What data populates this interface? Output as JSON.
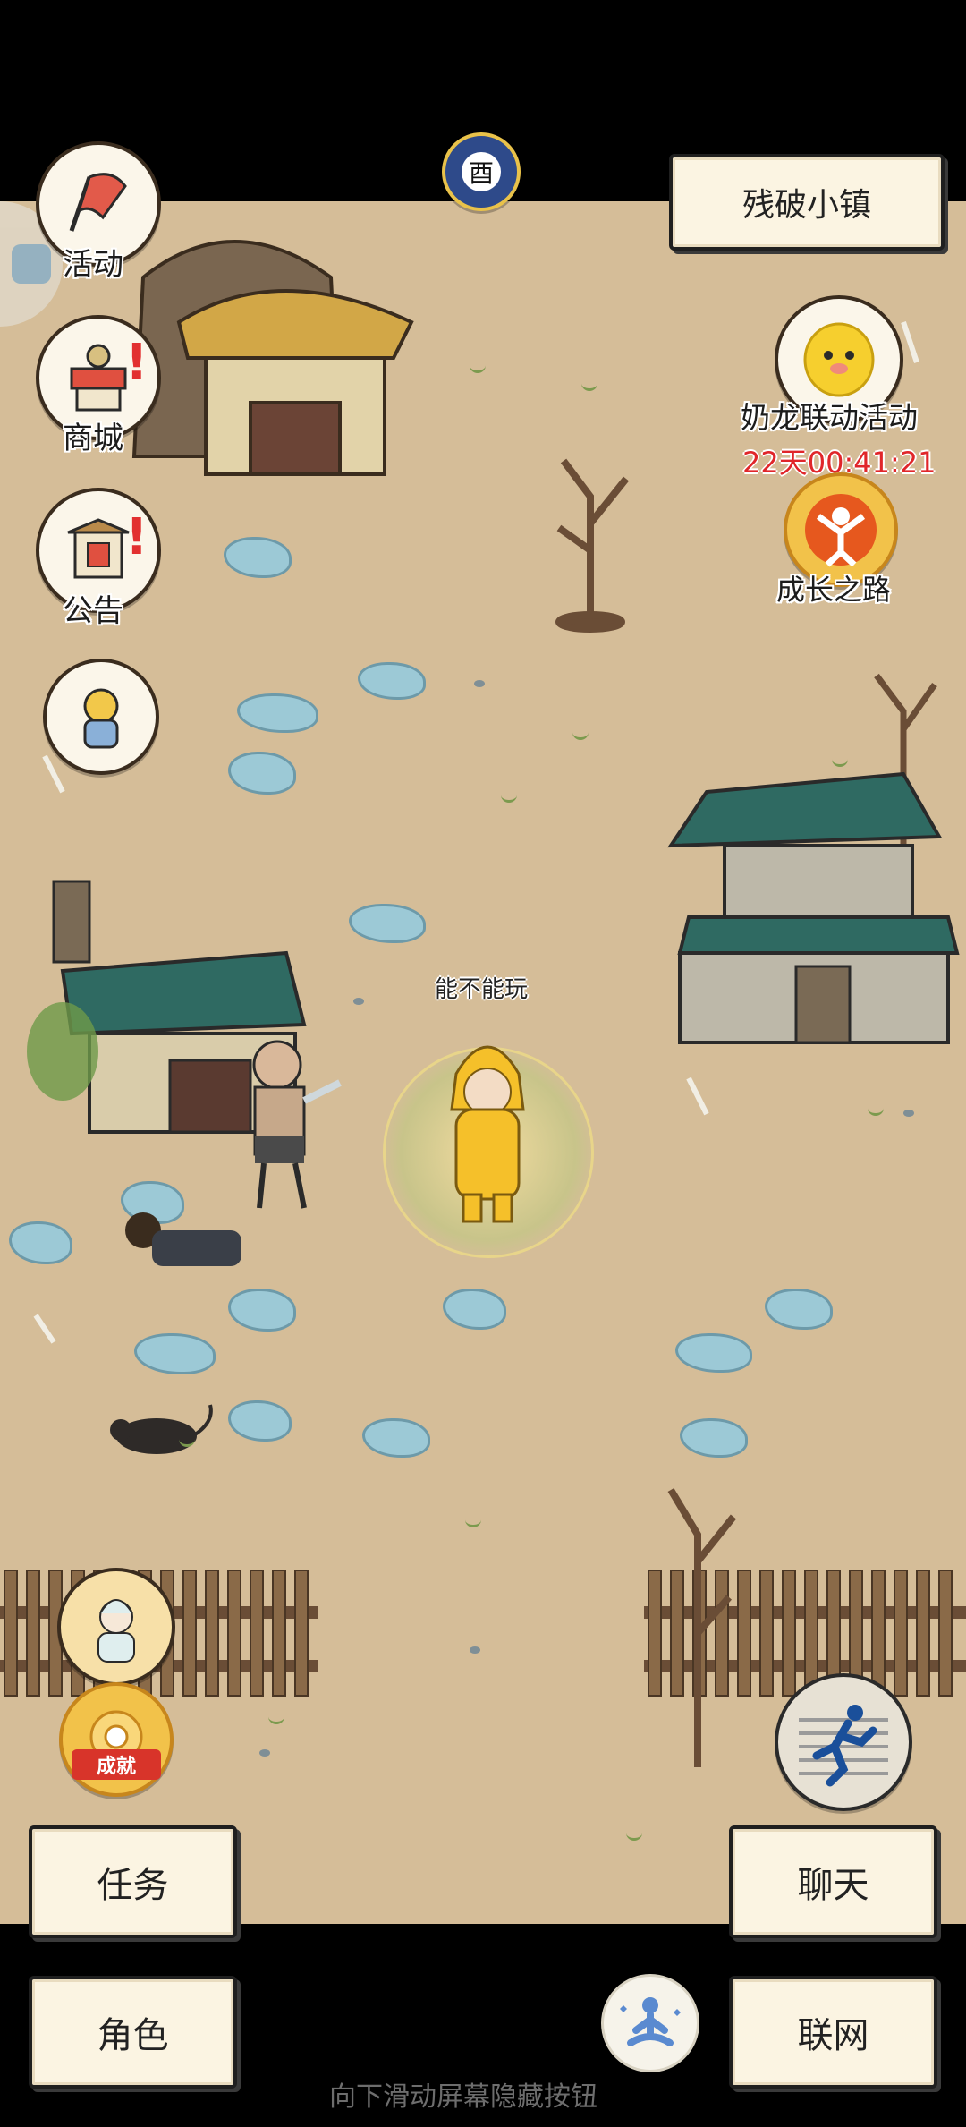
{
  "location": {
    "name": "残破小镇"
  },
  "left_menu": {
    "events_label": "活动",
    "shop_label": "商城",
    "notice_label": "公告"
  },
  "right_menu": {
    "collab_event_label": "奶龙联动活动",
    "collab_timer": "22天00:41:21",
    "growth_label": "成长之路"
  },
  "player": {
    "name": "能不能玩"
  },
  "achievement": {
    "badge_text": "成就"
  },
  "time_of_day": {
    "glyph": "酉"
  },
  "buttons": {
    "tasks": "任务",
    "chat": "聊天",
    "character": "角色",
    "online": "联网"
  },
  "hint": {
    "text": "向下滑动屏幕隐藏按钮"
  },
  "colors": {
    "ground": "#d5bd98",
    "timer": "#e0262a",
    "alert": "#e23030",
    "stone": "#9cc9d6"
  }
}
